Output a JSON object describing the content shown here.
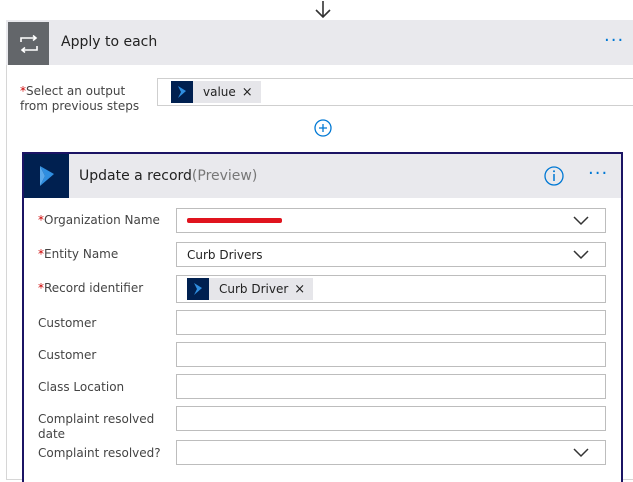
{
  "apply_to_each": {
    "title": "Apply to each",
    "more_label": "···",
    "select_output_label_line1": "Select an output",
    "select_output_label_line2": "from previous steps",
    "required_mark": "*",
    "token": {
      "label": "value",
      "remove": "×"
    }
  },
  "update_record": {
    "title": "Update a record",
    "preview": "(Preview)",
    "more_label": "···",
    "fields": {
      "organization_name": {
        "label": "Organization Name",
        "required": true,
        "value": ""
      },
      "entity_name": {
        "label": "Entity Name",
        "required": true,
        "value": "Curb Drivers"
      },
      "record_identifier": {
        "label": "Record identifier",
        "required": true,
        "token": "Curb Driver",
        "remove": "×"
      },
      "customer_1": {
        "label": "Customer",
        "value": ""
      },
      "customer_2": {
        "label": "Customer",
        "value": ""
      },
      "class_location": {
        "label": "Class Location",
        "value": ""
      },
      "complaint_resolved_date": {
        "label_line1": "Complaint resolved",
        "label_line2": "date",
        "value": ""
      },
      "complaint_resolved": {
        "label": "Complaint resolved?",
        "value": ""
      }
    }
  },
  "colors": {
    "accent": "#0078d4",
    "dynamics_navy": "#002050",
    "card_border": "#1b1464",
    "header_bg": "#e9e9ed",
    "redaction": "#e0141e"
  },
  "icons": [
    "down-arrow-icon",
    "loop-icon",
    "dynamics-icon",
    "add-circle-icon",
    "info-icon",
    "chevron-down-icon"
  ]
}
